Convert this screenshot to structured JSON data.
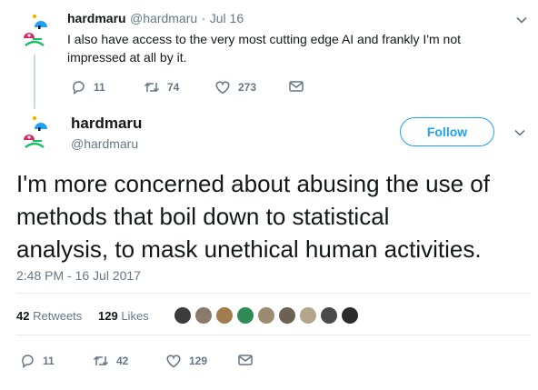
{
  "reply_tweet": {
    "display_name": "hardmaru",
    "handle": "@hardmaru",
    "separator": "·",
    "date": "Jul 16",
    "text_line1": "I also have access to the very most cutting edge AI and frankly I'm not",
    "text_line2": "impressed at all by it.",
    "replies": "11",
    "retweets": "74",
    "likes": "273"
  },
  "main_tweet": {
    "display_name": "hardmaru",
    "handle": "@hardmaru",
    "follow_label": "Follow",
    "text_line1": "I'm more concerned about abusing the use of",
    "text_line2": "methods that boil down to statistical",
    "text_line3": "analysis, to mask unethical human activities.",
    "timestamp": "2:48 PM - 16 Jul 2017",
    "retweets_count": "42",
    "retweets_label": "Retweets",
    "likes_count": "129",
    "likes_label": "Likes",
    "replies": "11",
    "retweets": "42",
    "likes": "129"
  },
  "colors": {
    "accent": "#1da1f2",
    "muted": "#657786",
    "text": "#14171a",
    "divider": "#e6ecf0"
  },
  "icons": [
    "reply-icon",
    "retweet-icon",
    "like-icon",
    "dm-icon",
    "chevron-down-icon"
  ]
}
